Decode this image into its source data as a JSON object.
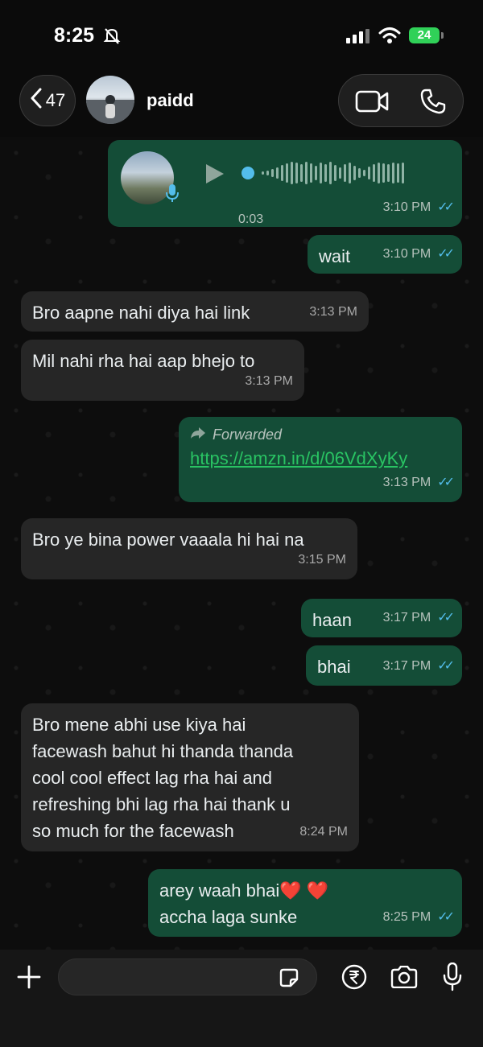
{
  "status": {
    "time": "8:25",
    "battery": "24"
  },
  "header": {
    "back_count": "47",
    "contact_name": "paidd"
  },
  "messages": {
    "voice": {
      "duration": "0:03",
      "time": "3:10 PM"
    },
    "m1": {
      "text": "wait",
      "time": "3:10 PM"
    },
    "m2": {
      "text": "Bro aapne nahi diya hai link",
      "time": "3:13 PM"
    },
    "m3": {
      "text": "Mil nahi rha hai aap bhejo to",
      "time": "3:13 PM"
    },
    "m4": {
      "forwarded_label": "Forwarded",
      "link": "https://amzn.in/d/06VdXyKy",
      "time": "3:13 PM"
    },
    "m5": {
      "text": "Bro ye bina power vaaala hi hai na",
      "time": "3:15 PM"
    },
    "m6": {
      "text": "haan",
      "time": "3:17 PM"
    },
    "m7": {
      "text": "bhai",
      "time": "3:17 PM"
    },
    "m8": {
      "lines": [
        "Bro mene abhi use kiya hai",
        "facewash bahut hi thanda thanda",
        "cool cool effect lag rha hai and",
        "refreshing bhi lag rha hai thank u",
        "so much for the facewash"
      ],
      "time": "8:24 PM"
    },
    "m9": {
      "lines": [
        "arey waah bhai❤️ ❤️",
        "accha laga sunke"
      ],
      "time": "8:25 PM"
    }
  },
  "icons": [
    "muted-bell-icon",
    "signal-icon",
    "wifi-icon",
    "battery-icon",
    "chevron-left-icon",
    "video-call-icon",
    "phone-icon",
    "play-icon",
    "mic-icon",
    "double-check-icon",
    "forward-arrow-icon",
    "plus-icon",
    "sticker-icon",
    "rupee-icon",
    "camera-icon"
  ],
  "colors": {
    "outgoing": "#144d37",
    "incoming": "#262626",
    "read_ticks": "#53bdeb",
    "link": "#29c463",
    "battery": "#30d158"
  }
}
